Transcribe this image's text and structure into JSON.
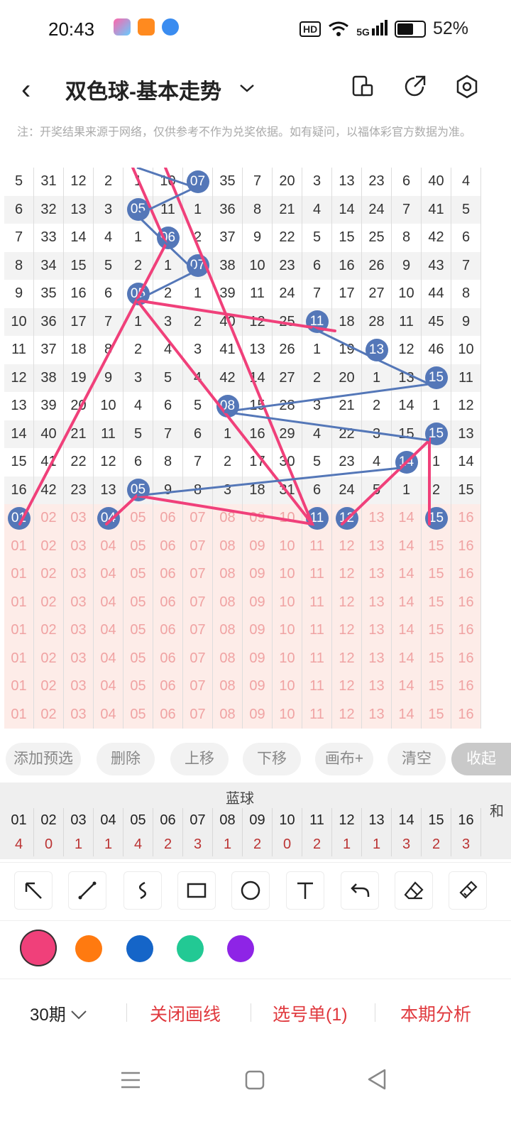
{
  "status": {
    "time": "20:43",
    "hd": "HD",
    "signal": "5G",
    "battery": "52%"
  },
  "header": {
    "title": "双色球-基本走势"
  },
  "note": "注：开奖结果来源于网络，仅供参考不作为兑奖依据。如有疑问，以福体彩官方数据为准。",
  "grid": {
    "rows": [
      [
        "5",
        "31",
        "12",
        "2",
        "1",
        "10",
        "07",
        "35",
        "7",
        "20",
        "3",
        "13",
        "23",
        "6",
        "40",
        "4"
      ],
      [
        "6",
        "32",
        "13",
        "3",
        "05",
        "11",
        "1",
        "36",
        "8",
        "21",
        "4",
        "14",
        "24",
        "7",
        "41",
        "5"
      ],
      [
        "7",
        "33",
        "14",
        "4",
        "1",
        "06",
        "2",
        "37",
        "9",
        "22",
        "5",
        "15",
        "25",
        "8",
        "42",
        "6"
      ],
      [
        "8",
        "34",
        "15",
        "5",
        "2",
        "1",
        "07",
        "38",
        "10",
        "23",
        "6",
        "16",
        "26",
        "9",
        "43",
        "7"
      ],
      [
        "9",
        "35",
        "16",
        "6",
        "05",
        "2",
        "1",
        "39",
        "11",
        "24",
        "7",
        "17",
        "27",
        "10",
        "44",
        "8"
      ],
      [
        "10",
        "36",
        "17",
        "7",
        "1",
        "3",
        "2",
        "40",
        "12",
        "25",
        "11",
        "18",
        "28",
        "11",
        "45",
        "9"
      ],
      [
        "11",
        "37",
        "18",
        "8",
        "2",
        "4",
        "3",
        "41",
        "13",
        "26",
        "1",
        "19",
        "13",
        "12",
        "46",
        "10"
      ],
      [
        "12",
        "38",
        "19",
        "9",
        "3",
        "5",
        "4",
        "42",
        "14",
        "27",
        "2",
        "20",
        "1",
        "13",
        "15",
        "11"
      ],
      [
        "13",
        "39",
        "20",
        "10",
        "4",
        "6",
        "5",
        "08",
        "15",
        "28",
        "3",
        "21",
        "2",
        "14",
        "1",
        "12"
      ],
      [
        "14",
        "40",
        "21",
        "11",
        "5",
        "7",
        "6",
        "1",
        "16",
        "29",
        "4",
        "22",
        "3",
        "15",
        "15",
        "13"
      ],
      [
        "15",
        "41",
        "22",
        "12",
        "6",
        "8",
        "7",
        "2",
        "17",
        "30",
        "5",
        "23",
        "4",
        "14",
        "1",
        "14"
      ],
      [
        "16",
        "42",
        "23",
        "13",
        "05",
        "9",
        "8",
        "3",
        "18",
        "31",
        "6",
        "24",
        "5",
        "1",
        "2",
        "15"
      ],
      [
        "01",
        "02",
        "03",
        "04",
        "05",
        "06",
        "07",
        "08",
        "09",
        "10",
        "11",
        "12",
        "13",
        "14",
        "15",
        "16"
      ]
    ],
    "pred_rows": 7,
    "pred_values": [
      "01",
      "02",
      "03",
      "04",
      "05",
      "06",
      "07",
      "08",
      "09",
      "10",
      "11",
      "12",
      "13",
      "14",
      "15",
      "16"
    ]
  },
  "toolbar": {
    "add": "添加预选",
    "delete": "删除",
    "up": "上移",
    "down": "下移",
    "canvas": "画布+",
    "clear": "清空",
    "collapse": "收起"
  },
  "summary": {
    "label": "蓝球",
    "extra": "和",
    "nums": [
      "01",
      "02",
      "03",
      "04",
      "05",
      "06",
      "07",
      "08",
      "09",
      "10",
      "11",
      "12",
      "13",
      "14",
      "15",
      "16"
    ],
    "counts": [
      "4",
      "0",
      "1",
      "1",
      "4",
      "2",
      "3",
      "1",
      "2",
      "0",
      "2",
      "1",
      "1",
      "3",
      "2",
      "3"
    ]
  },
  "tools": [
    "arrow-icon",
    "line-icon",
    "curve-icon",
    "rect-icon",
    "circle-icon",
    "text-icon",
    "undo-icon",
    "eraser-icon",
    "clear-brush-icon"
  ],
  "colors": [
    "#f0407a",
    "#ff7a10",
    "#1565c8",
    "#22c994",
    "#8e24e6"
  ],
  "bottom": {
    "period": "30期",
    "close_draw": "关闭画线",
    "select": "选号单(1)",
    "analysis": "本期分析"
  }
}
